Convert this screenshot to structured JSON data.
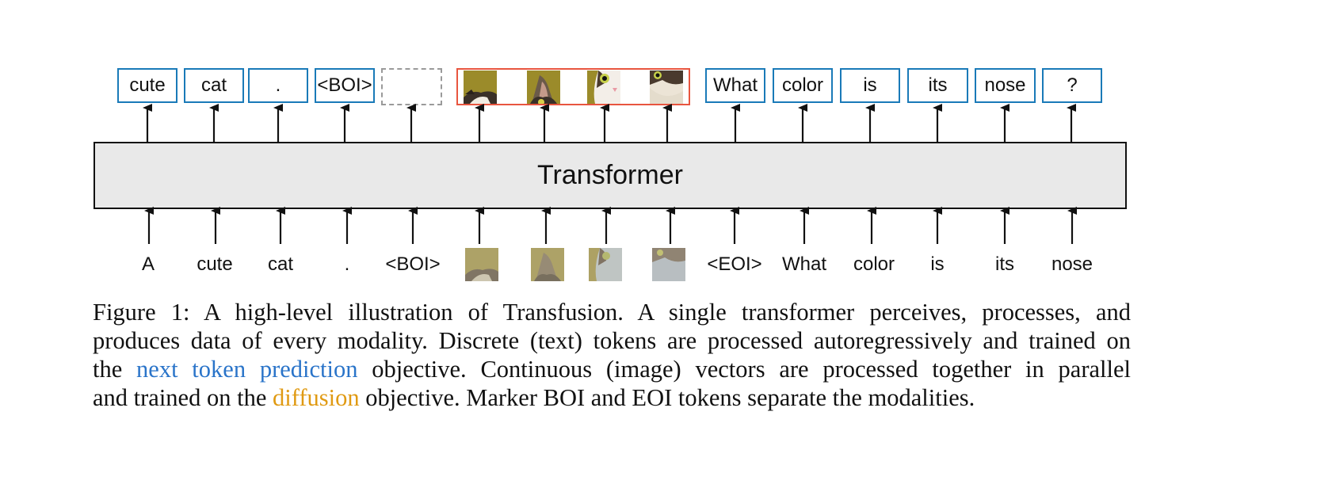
{
  "diagram": {
    "transformer_label": "Transformer",
    "output_tokens": [
      {
        "type": "text",
        "label": "cute"
      },
      {
        "type": "text",
        "label": "cat"
      },
      {
        "type": "text",
        "label": "."
      },
      {
        "type": "text",
        "label": "<BOI>"
      },
      {
        "type": "placeholder",
        "label": ""
      },
      {
        "type": "image",
        "label": "cat-patch-1"
      },
      {
        "type": "image",
        "label": "cat-patch-2"
      },
      {
        "type": "image",
        "label": "cat-patch-3"
      },
      {
        "type": "image",
        "label": "cat-patch-4"
      },
      {
        "type": "text",
        "label": "What"
      },
      {
        "type": "text",
        "label": "color"
      },
      {
        "type": "text",
        "label": "is"
      },
      {
        "type": "text",
        "label": "its"
      },
      {
        "type": "text",
        "label": "nose"
      },
      {
        "type": "text",
        "label": "?"
      }
    ],
    "input_tokens": [
      {
        "type": "text",
        "label": "A"
      },
      {
        "type": "text",
        "label": "cute"
      },
      {
        "type": "text",
        "label": "cat"
      },
      {
        "type": "text",
        "label": "."
      },
      {
        "type": "text",
        "label": "<BOI>"
      },
      {
        "type": "noisy-image",
        "label": "noisy-cat-patch-1"
      },
      {
        "type": "noisy-image",
        "label": "noisy-cat-patch-2"
      },
      {
        "type": "noisy-image",
        "label": "noisy-cat-patch-3"
      },
      {
        "type": "noisy-image",
        "label": "noisy-cat-patch-4"
      },
      {
        "type": "text",
        "label": "<EOI>"
      },
      {
        "type": "text",
        "label": "What"
      },
      {
        "type": "text",
        "label": "color"
      },
      {
        "type": "text",
        "label": "is"
      },
      {
        "type": "text",
        "label": "its"
      },
      {
        "type": "text",
        "label": "nose"
      }
    ],
    "colors": {
      "text_token_border": "#1a7ab8",
      "image_group_border": "#e8553f",
      "placeholder_border": "#9a9a9a",
      "transformer_fill": "#e9e9e9",
      "next_token_prediction": "#2a74c9",
      "diffusion": "#e09a12"
    }
  },
  "caption": {
    "line1": "Figure 1: A high-level illustration of Transfusion. A single transformer perceives, processes, and",
    "line2": "produces data of every modality. Discrete (text) tokens are processed autoregressively and trained on",
    "line3_pre": "the ",
    "line3_highlight": "next token prediction",
    "line3_post": " objective. Continuous (image) vectors are processed together in parallel",
    "line4_pre": "and trained on the ",
    "line4_highlight": "diffusion",
    "line4_post": " objective. Marker BOI and EOI tokens separate the modalities."
  }
}
